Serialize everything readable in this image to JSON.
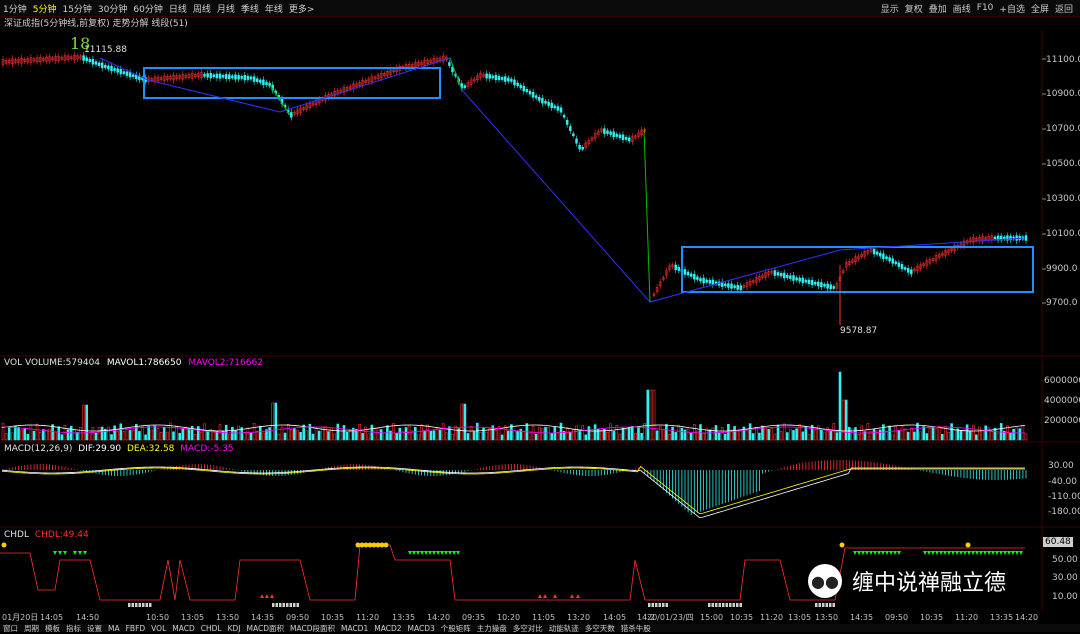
{
  "toolbar": {
    "periods": [
      "1分钟",
      "5分钟",
      "15分钟",
      "30分钟",
      "60分钟",
      "日线",
      "周线",
      "月线",
      "季线",
      "年线",
      "更多>"
    ],
    "active_period": "5分钟",
    "right_items": [
      "显示",
      "复权",
      "叠加",
      "画线",
      "F10",
      "+自选",
      "全屏",
      "返回"
    ]
  },
  "chart_title": "深证成指(5分钟线,前复权) 走势分解 线段(51)",
  "annotations": {
    "top_number": "18",
    "high_label": "11115.88",
    "low_label": "9578.87"
  },
  "price_axis": [
    "11100.0",
    "10900.0",
    "10700.0",
    "10500.0",
    "10300.0",
    "10100.0",
    "9900.0",
    "9700.0"
  ],
  "volume_panel": {
    "label": "VOL VOLUME:579404",
    "mavol1": "MAVOL1:786650",
    "mavol2": "MAVOL2:716662",
    "axis": [
      "6000000",
      "4000000",
      "2000000"
    ]
  },
  "macd_panel": {
    "label": "MACD(12,26,9)",
    "dif": "DIF:29.90",
    "dea": "DEA:32.58",
    "macd": "MACD:-5.35",
    "axis": [
      "30.00",
      "-40.00",
      "-110.00",
      "-180.00"
    ]
  },
  "chdl_panel": {
    "label": "CHDL",
    "value": "CHDL:49.44",
    "axis": [
      "60.48",
      "50.00",
      "30.00",
      "10.00"
    ],
    "current_badge": "60.48"
  },
  "time_axis": [
    "01月20日",
    "14:05",
    "14:50",
    "10:50",
    "13:05",
    "13:50",
    "14:35",
    "09:50",
    "10:35",
    "11:20",
    "13:35",
    "14:20",
    "09:35",
    "10:20",
    "11:05",
    "13:20",
    "14:05",
    "14:2",
    "20/01/23/四",
    "15:00",
    "10:35",
    "11:20",
    "13:05",
    "13:50",
    "14:35",
    "09:50",
    "10:35",
    "11:20",
    "13:35",
    "14:20"
  ],
  "bottom_tabs": [
    "窗口",
    "周期",
    "模板",
    "指标",
    "设置",
    "MA",
    "FBFD",
    "VOL",
    "MACD",
    "CHDL",
    "KDJ",
    "MACD面积",
    "MACD段面积",
    "MACD1",
    "MACD2",
    "MACD3",
    "个股矩阵",
    "主力操盘",
    "多空对比",
    "动能轨迹",
    "多空天数",
    "猎杀牛股"
  ],
  "watermark": "缠中说禅融立德",
  "colors": {
    "up": "#ff3030",
    "down": "#30f0f0",
    "stroke": "#3030ff",
    "box": "#1e90ff",
    "yellow": "#ffff00",
    "magenta": "#ff00ff"
  }
}
